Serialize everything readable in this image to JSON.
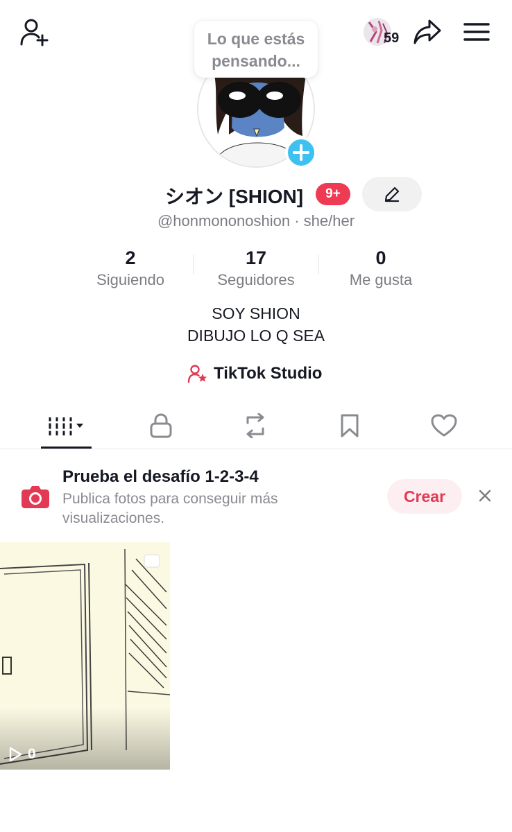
{
  "header": {
    "add_friend_icon": "person-plus-icon",
    "note_placeholder": "Lo que estás pensando...",
    "friends_count": "59",
    "share_icon": "share-arrow-icon",
    "menu_icon": "hamburger-menu-icon"
  },
  "profile": {
    "display_name": "シオン [SHION]",
    "notification_badge": "9+",
    "username": "@honmononoshion · she/her",
    "edit_icon": "pencil-icon"
  },
  "stats": [
    {
      "value": "2",
      "label": "Siguiendo"
    },
    {
      "value": "17",
      "label": "Seguidores"
    },
    {
      "value": "0",
      "label": "Me gusta"
    }
  ],
  "bio": {
    "line1": "SOY SHION",
    "line2": "DIBUJO LO Q SEA"
  },
  "studio": {
    "label": "TikTok Studio",
    "icon": "person-star-icon"
  },
  "tabs": [
    {
      "icon": "grid-videos-icon",
      "selected": true
    },
    {
      "icon": "lock-icon",
      "selected": false
    },
    {
      "icon": "repost-icon",
      "selected": false
    },
    {
      "icon": "bookmark-icon",
      "selected": false
    },
    {
      "icon": "heart-icon",
      "selected": false
    }
  ],
  "banner": {
    "title": "Prueba el desafío 1-2-3-4",
    "description": "Publica fotos para conseguir más visualizaciones.",
    "button_label": "Crear",
    "close_icon": "close-x-icon"
  },
  "videos": [
    {
      "views": "0",
      "play_icon": "play-icon"
    }
  ],
  "colors": {
    "accent": "#ee3a52",
    "avatar_plus": "#3ec1f1",
    "text_primary": "#161823",
    "text_secondary": "#7b7c82"
  }
}
